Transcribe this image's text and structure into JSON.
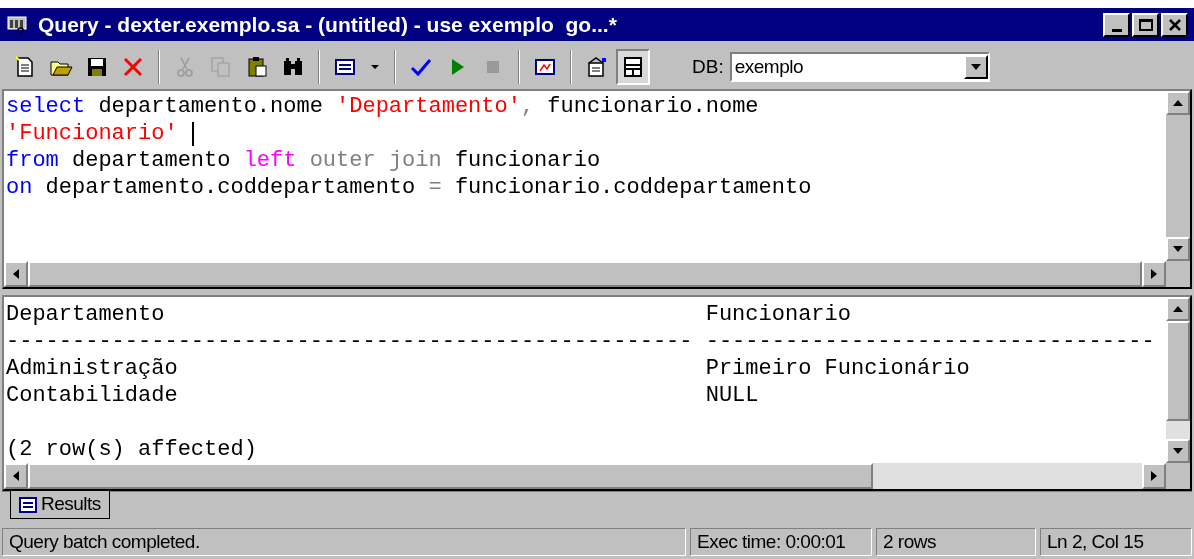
{
  "window": {
    "title": "Query - dexter.exemplo.sa - (untitled) - use exemplo  go...*"
  },
  "toolbar": [
    {
      "kind": "new",
      "disabled": false,
      "pressed": false
    },
    {
      "kind": "open",
      "disabled": false,
      "pressed": false
    },
    {
      "kind": "save",
      "disabled": false,
      "pressed": false
    },
    {
      "kind": "delete",
      "disabled": false,
      "pressed": false
    },
    {
      "kind": "separator"
    },
    {
      "kind": "cut",
      "disabled": true,
      "pressed": false
    },
    {
      "kind": "copy",
      "disabled": true,
      "pressed": false
    },
    {
      "kind": "paste",
      "disabled": false,
      "pressed": false
    },
    {
      "kind": "find",
      "disabled": false,
      "pressed": false
    },
    {
      "kind": "separator"
    },
    {
      "kind": "results-mode",
      "disabled": false,
      "pressed": false
    },
    {
      "kind": "dropdown",
      "disabled": false,
      "pressed": false
    },
    {
      "kind": "separator"
    },
    {
      "kind": "parse",
      "disabled": false,
      "pressed": false
    },
    {
      "kind": "execute",
      "disabled": false,
      "pressed": false
    },
    {
      "kind": "stop",
      "disabled": true,
      "pressed": false
    },
    {
      "kind": "separator"
    },
    {
      "kind": "plan",
      "disabled": false,
      "pressed": false
    },
    {
      "kind": "separator"
    },
    {
      "kind": "options",
      "disabled": false,
      "pressed": false
    },
    {
      "kind": "panes",
      "disabled": false,
      "pressed": true
    }
  ],
  "db": {
    "label": "DB:",
    "value": "exemplo"
  },
  "editor": {
    "lines": [
      [
        {
          "kind": "keyword",
          "text": "select"
        },
        {
          "kind": "plain",
          "text": " departamento.nome "
        },
        {
          "kind": "string",
          "text": "'Departamento'"
        },
        {
          "kind": "operator",
          "text": ","
        },
        {
          "kind": "plain",
          "text": " funcionario.nome"
        }
      ],
      [
        {
          "kind": "string",
          "text": "'Funcionario'",
          "caret_after": true
        }
      ],
      [
        {
          "kind": "keyword",
          "text": "from"
        },
        {
          "kind": "plain",
          "text": " departamento "
        },
        {
          "kind": "function",
          "text": "left"
        },
        {
          "kind": "operator",
          "text": " outer join"
        },
        {
          "kind": "plain",
          "text": " funcionario"
        }
      ],
      [
        {
          "kind": "keyword",
          "text": "on"
        },
        {
          "kind": "plain",
          "text": " departamento.coddepartamento "
        },
        {
          "kind": "operator",
          "text": "="
        },
        {
          "kind": "plain",
          "text": " funcionario.coddepartamento"
        }
      ]
    ]
  },
  "results": {
    "lines": [
      "Departamento                                         Funcionario",
      "---------------------------------------------------- ----------------------------------",
      "Administração                                        Primeiro Funcionário",
      "Contabilidade                                        NULL"
    ],
    "message": {
      "text": "(2 row(s) affected)"
    }
  },
  "tabs": [
    {
      "label": "Results",
      "selected": true
    }
  ],
  "status_bar": [
    "Query batch completed.",
    "Exec time: 0:00:01",
    "2 rows",
    "Ln 2, Col 15"
  ]
}
